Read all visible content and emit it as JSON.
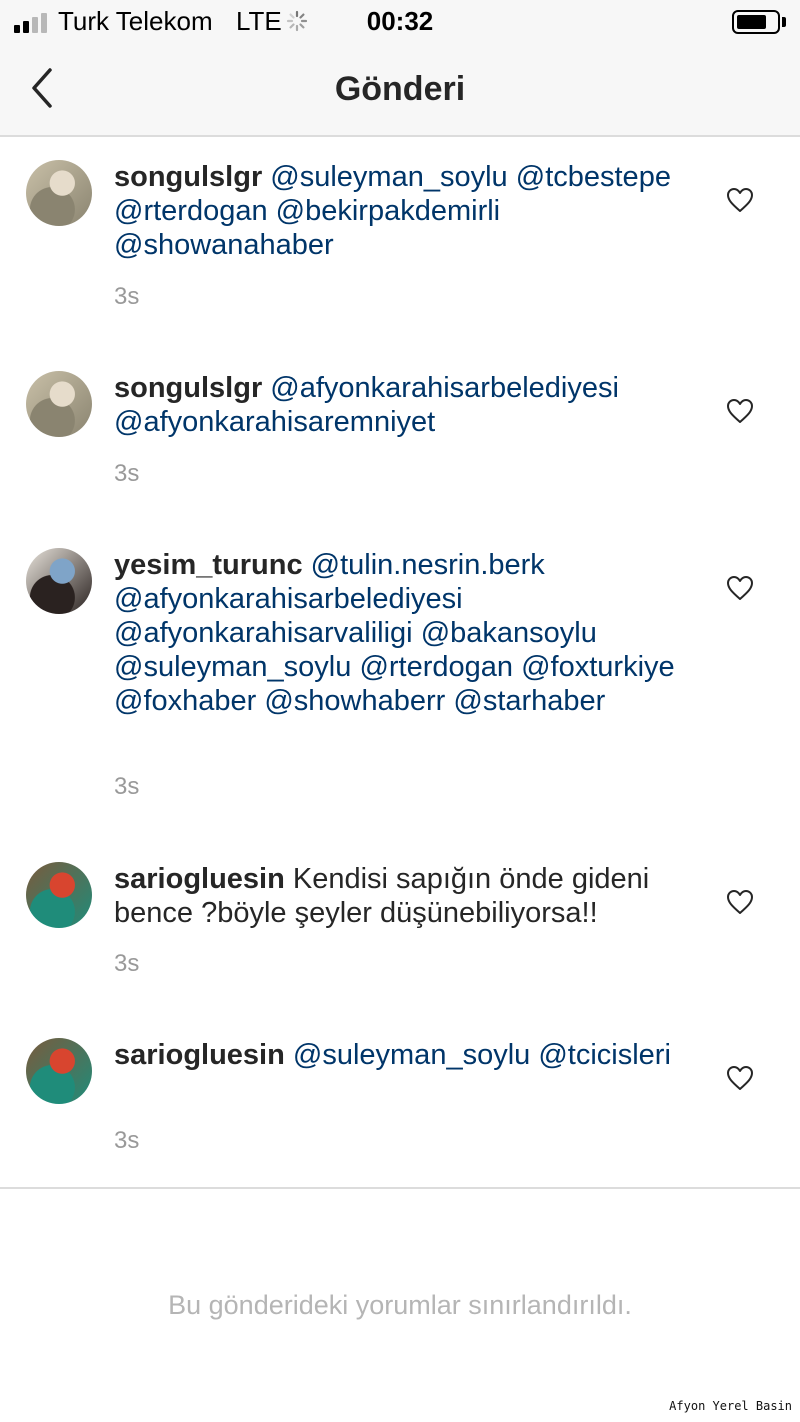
{
  "status_bar": {
    "carrier": "Turk Telekom",
    "network": "LTE",
    "time": "00:32",
    "signal_bars_filled": 2,
    "signal_bars_total": 4,
    "battery_level": 0.75
  },
  "nav": {
    "title": "Gönderi",
    "back_icon": "chevron-left-icon"
  },
  "comments": [
    {
      "username": "songulslgr",
      "parts": [
        "@suleyman_soylu",
        " ",
        "@tcbestepe",
        " ",
        "@rterdogan",
        " ",
        "@bekirpakdemirli",
        " ",
        "@showanahaber"
      ],
      "time": "3s",
      "avatar_colors": [
        "#c9c0a8",
        "#8a8470",
        "#e6dccb"
      ]
    },
    {
      "username": "songulslgr",
      "parts": [
        "@afyonkarahisarbelediyesi",
        " ",
        "@afyonkarahisaremniyet"
      ],
      "time": "3s",
      "avatar_colors": [
        "#c9c0a8",
        "#8a8470",
        "#e6dccb"
      ]
    },
    {
      "username": "yesim_turunc",
      "parts": [
        "@tulin.nesrin.berk",
        " ",
        "@afyonkarahisarbelediyesi",
        " ",
        "@afyonkarahisarvaliligi",
        " ",
        "@bakansoylu",
        " ",
        "@suleyman_soylu",
        " ",
        "@rterdogan",
        " ",
        "@foxturkiye",
        " ",
        "@foxhaber",
        " ",
        "@showhaberr",
        " ",
        "@starhaber"
      ],
      "time": "3s",
      "avatar_colors": [
        "#e9e4dc",
        "#2a2220",
        "#7fa4c8"
      ]
    },
    {
      "username": "sariogluesin",
      "parts": [
        "Kendisi sapığın önde gideni bence ?böyle şeyler düşünebiliyorsa!!"
      ],
      "time": "3s",
      "avatar_colors": [
        "#7a5a3c",
        "#1f8c7a",
        "#d8452f"
      ]
    },
    {
      "username": "sariogluesin",
      "parts": [
        "@suleyman_soylu",
        " ",
        "@tcicisleri"
      ],
      "time": "3s",
      "avatar_colors": [
        "#7a5a3c",
        "#1f8c7a",
        "#d8452f"
      ]
    }
  ],
  "like_icon": "heart-outline-icon",
  "restricted_note": "Bu gönderideki yorumlar sınırlandırıldı.",
  "watermark": "Afyon Yerel Basin",
  "colors": {
    "text": "#262626",
    "mention": "#003569",
    "muted": "#999999"
  }
}
